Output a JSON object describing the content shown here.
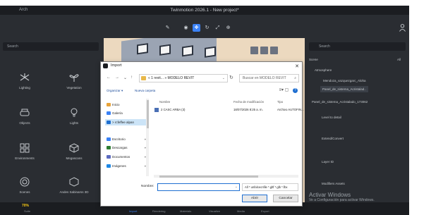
{
  "window": {
    "title": "Twinmotion 2026.1 - New project*",
    "menu": "Arch"
  },
  "left_panel": {
    "search_placeholder": "Search",
    "items": [
      {
        "label": "Lighting",
        "icon": "fan-icon"
      },
      {
        "label": "Vegetation",
        "icon": "plant-icon"
      },
      {
        "label": "Objects",
        "icon": "sofa-icon"
      },
      {
        "label": "Lights",
        "icon": "bulb-icon"
      },
      {
        "label": "Environments",
        "icon": "grid-icon"
      },
      {
        "label": "Megascans",
        "icon": "cube-icon"
      },
      {
        "label": "Scenes",
        "icon": "target-icon"
      },
      {
        "label": "Andes Sabinarss 3D",
        "icon": "cube-outline-icon"
      }
    ]
  },
  "right_panel": {
    "search_placeholder": "Search",
    "scene_label": "Scene",
    "scene_value": "All",
    "atmosphere_label": "Atmosphere",
    "items": [
      "Mendoza_vazquezgarc_Aloha",
      "Panel_de_sistema_Acristalad..",
      "Panel_de_sistema_Acristalado_173062",
      "Level to detail",
      "Extend/Convert",
      "Layer ID",
      "Modifiers Assets"
    ]
  },
  "bottombar": {
    "progress": "70%",
    "progress_sub": "Suite",
    "items": [
      "Import",
      "Rendering",
      "Materials",
      "Visualize",
      "Media",
      "Export"
    ]
  },
  "activate": {
    "title": "Activar Windows",
    "sub": "Ve a Configuración para activar Windows."
  },
  "dialog": {
    "title": "Import",
    "path": "« 1 revit... » MODELO REVIT",
    "search_placeholder": "Buscar en MODELO REVIT",
    "organize": "Organizar ▾",
    "new_folder": "Nueva carpeta",
    "nav_items": [
      {
        "label": "Inicio",
        "color": "#e8a33a"
      },
      {
        "label": "Galería",
        "color": "#3b82f6"
      },
      {
        "label": "> rcfeffee alpan",
        "color": "#1f6fd1"
      },
      {
        "label": "Escritorio",
        "color": "#3b82f6"
      },
      {
        "label": "Descargas",
        "color": "#2e7d32"
      },
      {
        "label": "Documentos",
        "color": "#5c6bc0"
      },
      {
        "label": "Imágenes",
        "color": "#1e88e5"
      }
    ],
    "columns": {
      "name": "Nombre",
      "date": "Fecha de modificación",
      "type": "Tipo"
    },
    "files": [
      {
        "name": "2 CASC ARBA (3)",
        "date": "18/07/2026 8:25 a. m.",
        "type": "Archivo AUTOFIN..."
      }
    ],
    "filename_label": "Nombre:",
    "filename_value": "",
    "filetype": "All * unfalcecnfile *.gltf *.glb *.fbx",
    "open_button": "Abrir",
    "cancel_button": "Cancelar"
  }
}
